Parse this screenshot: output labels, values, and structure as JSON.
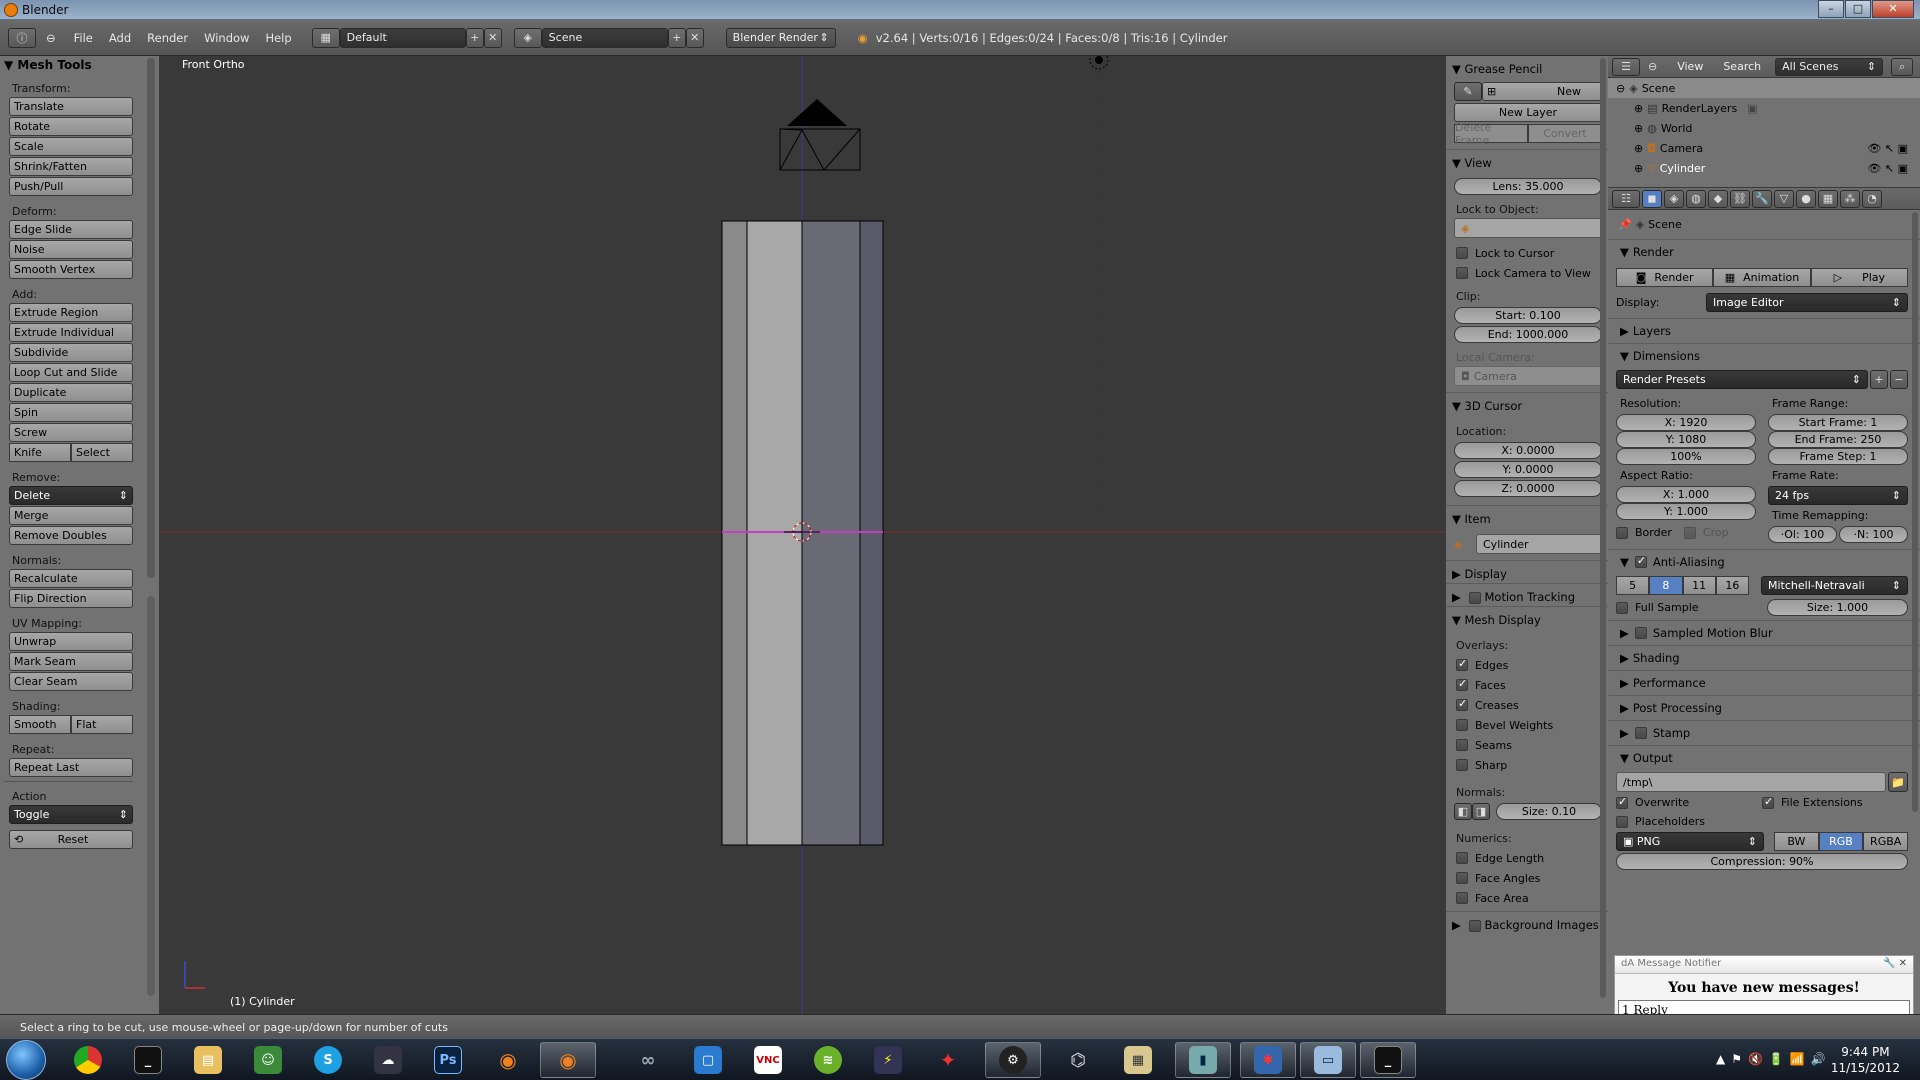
{
  "window": {
    "title": "Blender"
  },
  "infobar": {
    "menus": [
      "File",
      "Add",
      "Render",
      "Window",
      "Help"
    ],
    "layout": "Default",
    "scene": "Scene",
    "engine": "Blender Render",
    "stats": "v2.64 | Verts:0/16 | Edges:0/24 | Faces:0/8 | Tris:16 | Cylinder"
  },
  "tools": {
    "title": "Mesh Tools",
    "transform_label": "Transform:",
    "transform": [
      "Translate",
      "Rotate",
      "Scale",
      "Shrink/Fatten",
      "Push/Pull"
    ],
    "deform_label": "Deform:",
    "deform": [
      "Edge Slide",
      "Noise",
      "Smooth Vertex"
    ],
    "add_label": "Add:",
    "add": [
      "Extrude Region",
      "Extrude Individual",
      "Subdivide",
      "Loop Cut and Slide",
      "Duplicate",
      "Spin",
      "Screw"
    ],
    "knife": "Knife",
    "select": "Select",
    "remove_label": "Remove:",
    "delete": "Delete",
    "remove": [
      "Merge",
      "Remove Doubles"
    ],
    "normals_label": "Normals:",
    "normals": [
      "Recalculate",
      "Flip Direction"
    ],
    "uv_label": "UV Mapping:",
    "uv": [
      "Unwrap",
      "Mark Seam",
      "Clear Seam"
    ],
    "shading_label": "Shading:",
    "smooth": "Smooth",
    "flat": "Flat",
    "repeat_label": "Repeat:",
    "repeat_last": "Repeat Last",
    "action_label": "Action",
    "action_value": "Toggle",
    "reset": "Reset"
  },
  "viewport": {
    "label": "Front Ortho",
    "object": "(1) Cylinder"
  },
  "npanel": {
    "grease": "Grease Pencil",
    "new": "New",
    "new_layer": "New Layer",
    "delete_frame": "Delete Frame",
    "convert": "Convert",
    "view": "View",
    "lens": "Lens: 35.000",
    "lock_obj": "Lock to Object:",
    "lock_cursor": "Lock to Cursor",
    "lock_cam": "Lock Camera to View",
    "clip": "Clip:",
    "start": "Start: 0.100",
    "end": "End: 1000.000",
    "local_cam": "Local Camera:",
    "camera": "Camera",
    "cursor": "3D Cursor",
    "location": "Location:",
    "cx": "X: 0.0000",
    "cy": "Y: 0.0000",
    "cz": "Z: 0.0000",
    "item": "Item",
    "item_name": "Cylinder",
    "display": "Display",
    "motion": "Motion Tracking",
    "mesh_display": "Mesh Display",
    "overlays": "Overlays:",
    "overlay_items": [
      {
        "label": "Edges",
        "on": true
      },
      {
        "label": "Faces",
        "on": true
      },
      {
        "label": "Creases",
        "on": true
      },
      {
        "label": "Bevel Weights",
        "on": false
      },
      {
        "label": "Seams",
        "on": false
      },
      {
        "label": "Sharp",
        "on": false
      }
    ],
    "normals": "Normals:",
    "size": "Size: 0.10",
    "numerics": "Numerics:",
    "numeric_items": [
      "Edge Length",
      "Face Angles",
      "Face Area"
    ],
    "background": "Background Images"
  },
  "outliner": {
    "view": "View",
    "search": "Search",
    "filter": "All Scenes",
    "items": [
      {
        "label": "Scene",
        "indent": 0
      },
      {
        "label": "RenderLayers",
        "indent": 1
      },
      {
        "label": "World",
        "indent": 1
      },
      {
        "label": "Camera",
        "indent": 1
      },
      {
        "label": "Cylinder",
        "indent": 1
      }
    ]
  },
  "props": {
    "scene": "Scene",
    "render": "Render",
    "render_btn": "Render",
    "animation_btn": "Animation",
    "play_btn": "Play",
    "display_label": "Display:",
    "display_value": "Image Editor",
    "layers": "Layers",
    "dimensions": "Dimensions",
    "presets": "Render Presets",
    "resolution": "Resolution:",
    "resx": "X: 1920",
    "resy": "Y: 1080",
    "pct": "100%",
    "frame_range": "Frame Range:",
    "start_frame": "Start Frame: 1",
    "end_frame": "End Frame: 250",
    "frame_step": "Frame Step: 1",
    "aspect": "Aspect Ratio:",
    "ax": "X: 1.000",
    "ay": "Y: 1.000",
    "frame_rate": "Frame Rate:",
    "fps": "24 fps",
    "border": "Border",
    "crop": "Crop",
    "time_remap": "Time Remapping:",
    "old": "·Ol: 100",
    "new": "·N: 100",
    "aa": "Anti-Aliasing",
    "aa_samples": [
      "5",
      "8",
      "11",
      "16"
    ],
    "aa_filter": "Mitchell-Netravali",
    "full_sample": "Full Sample",
    "aa_size": "Size: 1.000",
    "sections": [
      "Sampled Motion Blur",
      "Shading",
      "Performance",
      "Post Processing",
      "Stamp"
    ],
    "output": "Output",
    "path": "/tmp\\",
    "overwrite": "Overwrite",
    "file_ext": "File Extensions",
    "placeholders": "Placeholders",
    "format": "PNG",
    "bw": "BW",
    "rgb": "RGB",
    "rgba": "RGBA",
    "compression": "Compression: 90%"
  },
  "status": {
    "text": "Select a ring to be cut, use mouse-wheel or page-up/down for number of cuts"
  },
  "notifier": {
    "title": "dA Message Notifier",
    "message": "You have new messages!",
    "reply": "1 Reply"
  },
  "taskbar": {
    "time": "9:44 PM",
    "date": "11/15/2012"
  }
}
